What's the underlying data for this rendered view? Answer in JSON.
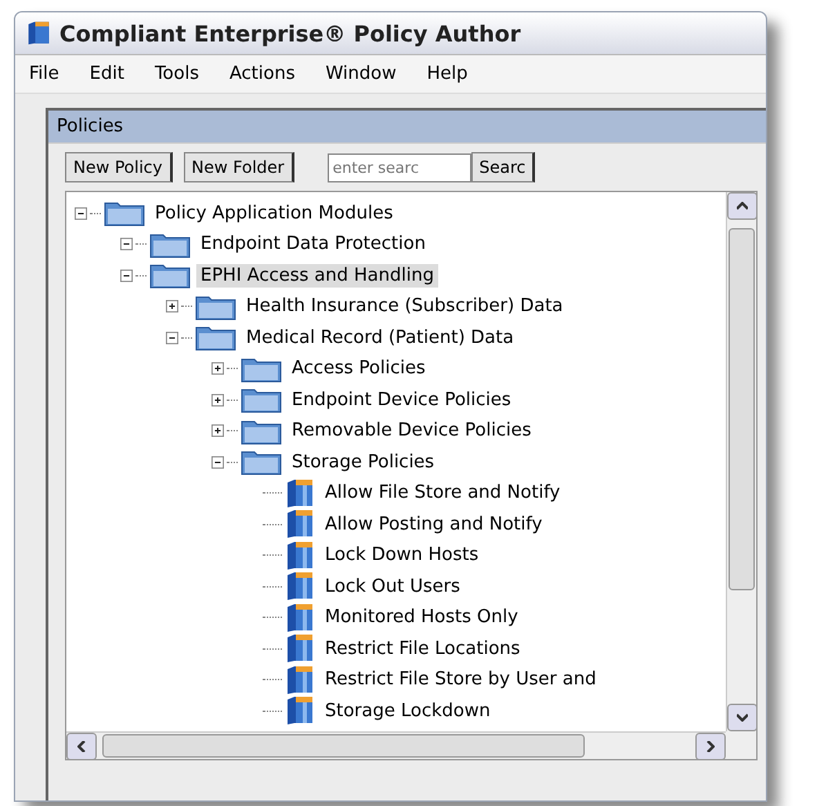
{
  "window": {
    "title": "Compliant Enterprise® Policy Author"
  },
  "menu": [
    "File",
    "Edit",
    "Tools",
    "Actions",
    "Window",
    "Help"
  ],
  "panel": {
    "title": "Policies",
    "buttons": [
      "New Policy",
      "New Folder"
    ],
    "search": {
      "placeholder": "enter searc",
      "button": "Searc"
    },
    "tree": [
      {
        "label": "Policy Application Modules",
        "kind": "folder",
        "expanded": true,
        "selected": false,
        "children": [
          {
            "label": "Endpoint Data Protection",
            "kind": "folder",
            "expanded": true,
            "selected": false
          },
          {
            "label": "EPHI Access and Handling",
            "kind": "folder",
            "expanded": true,
            "selected": true,
            "children": [
              {
                "label": "Health Insurance (Subscriber) Data",
                "kind": "folder",
                "expanded": false,
                "selected": false
              },
              {
                "label": "Medical Record (Patient) Data",
                "kind": "folder",
                "expanded": true,
                "selected": false,
                "children": [
                  {
                    "label": "Access Policies",
                    "kind": "folder",
                    "expanded": false,
                    "selected": false
                  },
                  {
                    "label": "Endpoint Device Policies",
                    "kind": "folder",
                    "expanded": false,
                    "selected": false
                  },
                  {
                    "label": "Removable Device Policies",
                    "kind": "folder",
                    "expanded": false,
                    "selected": false
                  },
                  {
                    "label": "Storage Policies",
                    "kind": "folder",
                    "expanded": true,
                    "selected": false,
                    "children": [
                      {
                        "label": "Allow File Store and Notify",
                        "kind": "policy",
                        "selected": false
                      },
                      {
                        "label": "Allow Posting and Notify",
                        "kind": "policy",
                        "selected": false
                      },
                      {
                        "label": "Lock Down Hosts",
                        "kind": "policy",
                        "selected": false
                      },
                      {
                        "label": "Lock Out Users",
                        "kind": "policy",
                        "selected": false
                      },
                      {
                        "label": "Monitored Hosts Only",
                        "kind": "policy",
                        "selected": false
                      },
                      {
                        "label": "Restrict File Locations",
                        "kind": "policy",
                        "selected": false
                      },
                      {
                        "label": "Restrict File Store by User and",
                        "kind": "policy",
                        "selected": false
                      },
                      {
                        "label": "Storage Lockdown",
                        "kind": "policy",
                        "selected": false
                      }
                    ]
                  }
                ]
              }
            ]
          }
        ]
      }
    ]
  }
}
